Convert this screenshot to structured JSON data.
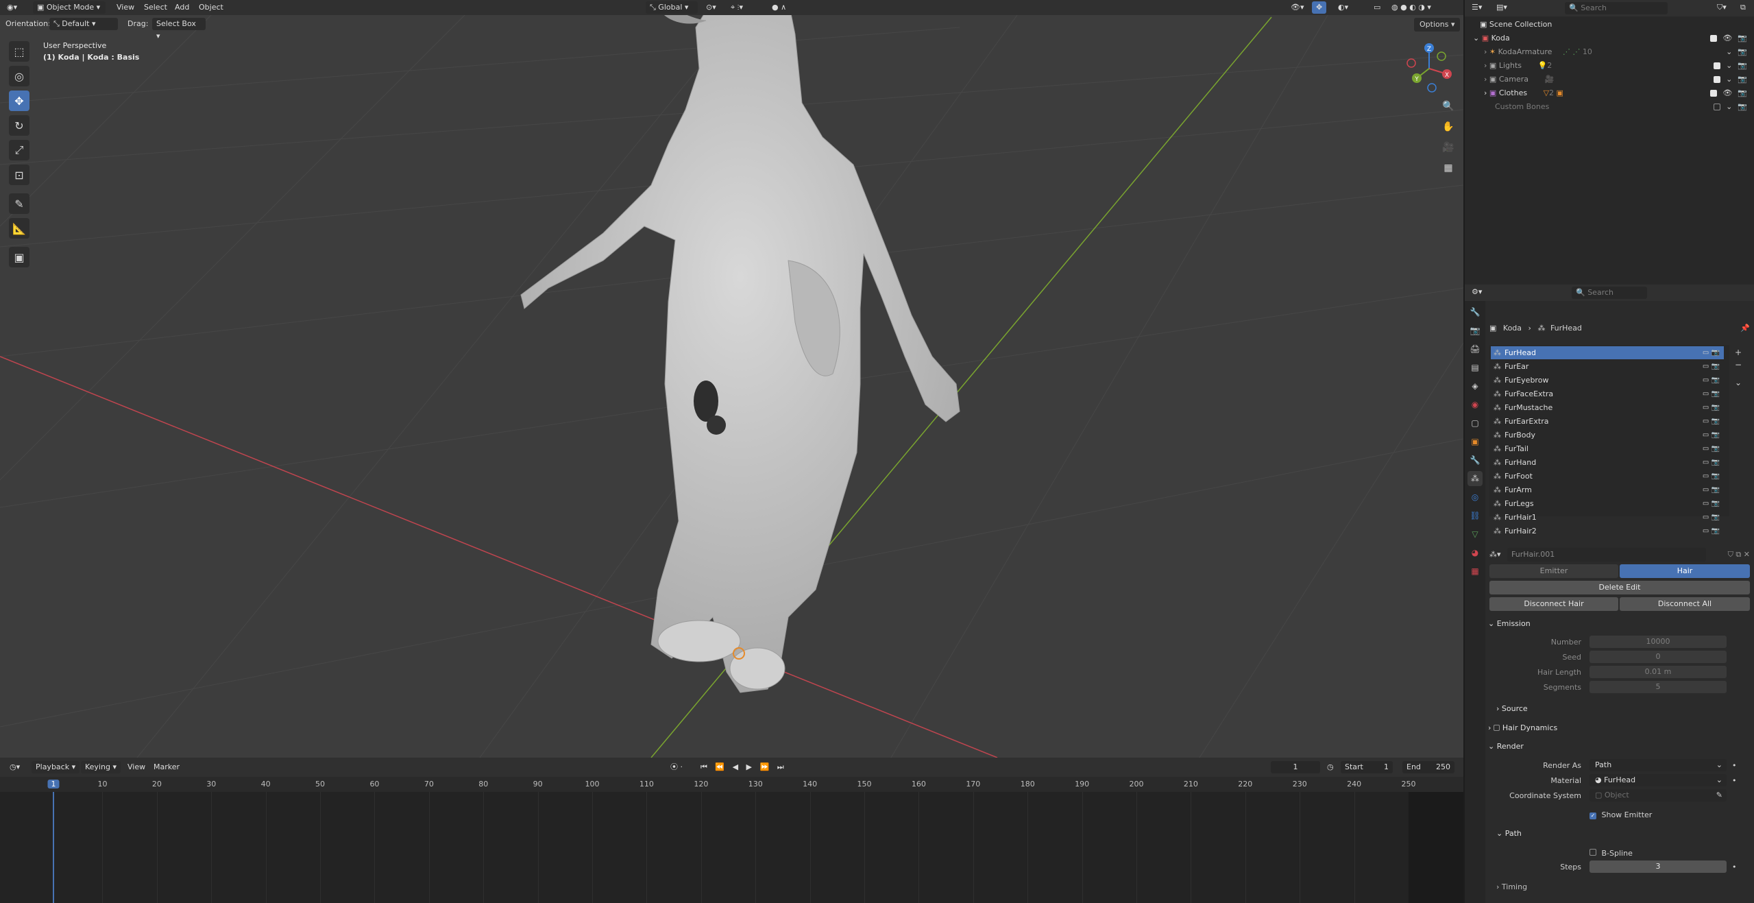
{
  "viewport": {
    "header": {
      "mode": "Object Mode",
      "menus": [
        "View",
        "Select",
        "Add",
        "Object"
      ],
      "transform_orientation": "Global"
    },
    "tool_header": {
      "orientation_label": "Orientation:",
      "orientation_value": "Default",
      "drag_label": "Drag:",
      "drag_value": "Select Box",
      "options_label": "Options"
    },
    "overlay_text": {
      "perspective": "User Perspective",
      "object": "(1) Koda | Koda : Basis"
    },
    "gizmo": {
      "x": "X",
      "y": "Y",
      "z": "Z"
    }
  },
  "timeline": {
    "menus": [
      "Playback",
      "Keying",
      "View",
      "Marker"
    ],
    "current_frame": "1",
    "start_label": "Start",
    "start_value": "1",
    "end_label": "End",
    "end_value": "250",
    "playhead_label": "1",
    "ticks": [
      "10",
      "20",
      "30",
      "40",
      "50",
      "60",
      "70",
      "80",
      "90",
      "100",
      "110",
      "120",
      "130",
      "140",
      "150",
      "160",
      "170",
      "180",
      "190",
      "200",
      "210",
      "220",
      "230",
      "240",
      "250"
    ]
  },
  "outliner": {
    "search_placeholder": "Search",
    "scene_collection": "Scene Collection",
    "items": [
      {
        "name": "Koda",
        "badge": ""
      },
      {
        "name": "KodaArmature",
        "badge": "10"
      },
      {
        "name": "Lights",
        "badge": "2"
      },
      {
        "name": "Camera",
        "badge": ""
      },
      {
        "name": "Clothes",
        "badge": "2"
      },
      {
        "name": "Custom Bones",
        "badge": ""
      }
    ]
  },
  "properties": {
    "search_placeholder": "Search",
    "breadcrumb": [
      "Koda",
      "FurHead"
    ],
    "particle_systems": [
      "FurHead",
      "FurEar",
      "FurEyebrow",
      "FurFaceExtra",
      "FurMustache",
      "FurEarExtra",
      "FurBody",
      "FurTail",
      "FurHand",
      "FurFoot",
      "FurArm",
      "FurLegs",
      "FurHair1",
      "FurHair2"
    ],
    "selected_system": "FurHead",
    "settings_name": "FurHair.001",
    "type_tabs": [
      "Emitter",
      "Hair"
    ],
    "active_type": "Hair",
    "delete_edit": "Delete Edit",
    "disconnect_hair": "Disconnect Hair",
    "disconnect_all": "Disconnect All",
    "emission": {
      "title": "Emission",
      "fields": [
        {
          "label": "Number",
          "value": "10000"
        },
        {
          "label": "Seed",
          "value": "0"
        },
        {
          "label": "Hair Length",
          "value": "0.01 m"
        },
        {
          "label": "Segments",
          "value": "5"
        }
      ],
      "source": "Source"
    },
    "hair_dynamics": "Hair Dynamics",
    "render": {
      "title": "Render",
      "render_as_label": "Render As",
      "render_as_value": "Path",
      "material_label": "Material",
      "material_value": "FurHead",
      "coord_label": "Coordinate System",
      "coord_placeholder": "Object",
      "show_emitter": "Show Emitter",
      "path_title": "Path",
      "bspline": "B-Spline",
      "steps_label": "Steps",
      "steps_value": "3",
      "timing": "Timing"
    }
  },
  "colors": {
    "accent": "#4772b3",
    "viewport_bg": "#3d3d3d",
    "x_axis": "#c0454f",
    "y_axis": "#7aa52f"
  }
}
